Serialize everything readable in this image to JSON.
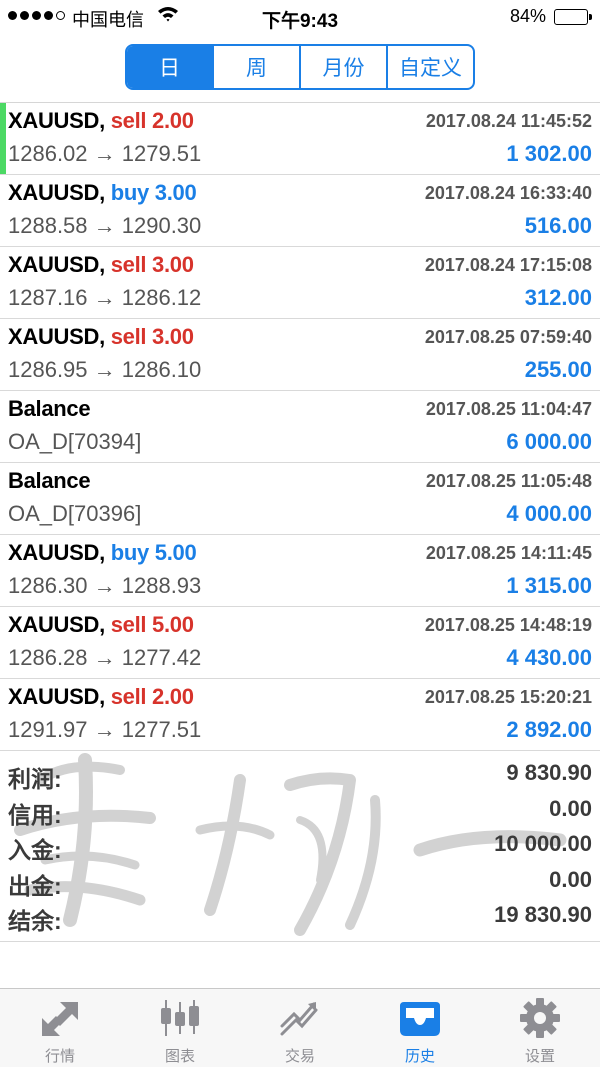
{
  "status_bar": {
    "carrier": "中国电信",
    "time": "下午9:43",
    "battery": "84%"
  },
  "period_tabs": [
    {
      "label": "日",
      "active": true
    },
    {
      "label": "周",
      "active": false
    },
    {
      "label": "月份",
      "active": false
    },
    {
      "label": "自定义",
      "active": false
    }
  ],
  "records": [
    {
      "symbol": "XAUUSD,",
      "side": "sell 2.00",
      "date": "2017.08.24 11:45:52",
      "detail": "1286.02 → 1279.51",
      "amount": "1 302.00"
    },
    {
      "symbol": "XAUUSD,",
      "side": "buy 3.00",
      "date": "2017.08.24 16:33:40",
      "detail": "1288.58 → 1290.30",
      "amount": "516.00"
    },
    {
      "symbol": "XAUUSD,",
      "side": "sell 3.00",
      "date": "2017.08.24 17:15:08",
      "detail": "1287.16 → 1286.12",
      "amount": "312.00"
    },
    {
      "symbol": "XAUUSD,",
      "side": "sell 3.00",
      "date": "2017.08.25 07:59:40",
      "detail": "1286.95 → 1286.10",
      "amount": "255.00"
    },
    {
      "symbol": "Balance",
      "side": "",
      "date": "2017.08.25 11:04:47",
      "detail": "OA_D[70394]",
      "amount": "6 000.00"
    },
    {
      "symbol": "Balance",
      "side": "",
      "date": "2017.08.25 11:05:48",
      "detail": "OA_D[70396]",
      "amount": "4 000.00"
    },
    {
      "symbol": "XAUUSD,",
      "side": "buy 5.00",
      "date": "2017.08.25 14:11:45",
      "detail": "1286.30 → 1288.93",
      "amount": "1 315.00"
    },
    {
      "symbol": "XAUUSD,",
      "side": "sell 5.00",
      "date": "2017.08.25 14:48:19",
      "detail": "1286.28 → 1277.42",
      "amount": "4 430.00"
    },
    {
      "symbol": "XAUUSD,",
      "side": "sell 2.00",
      "date": "2017.08.25 15:20:21",
      "detail": "1291.97 → 1277.51",
      "amount": "2 892.00"
    }
  ],
  "summary": [
    {
      "label": "利润:",
      "value": "9 830.90"
    },
    {
      "label": "信用:",
      "value": "0.00"
    },
    {
      "label": "入金:",
      "value": "10 000.00"
    },
    {
      "label": "出金:",
      "value": "0.00"
    },
    {
      "label": "结余:",
      "value": "19 830.90"
    }
  ],
  "tab_bar": [
    {
      "label": "行情",
      "icon": "quotes-arrows-icon",
      "active": false
    },
    {
      "label": "图表",
      "icon": "candlestick-chart-icon",
      "active": false
    },
    {
      "label": "交易",
      "icon": "trade-trend-icon",
      "active": false
    },
    {
      "label": "历史",
      "icon": "history-inbox-icon",
      "active": true
    },
    {
      "label": "设置",
      "icon": "gear-icon",
      "active": false
    }
  ],
  "colors": {
    "accent_blue": "#1a7fe6",
    "sell_red": "#d7332b",
    "active_row_marker": "#4cd964"
  }
}
